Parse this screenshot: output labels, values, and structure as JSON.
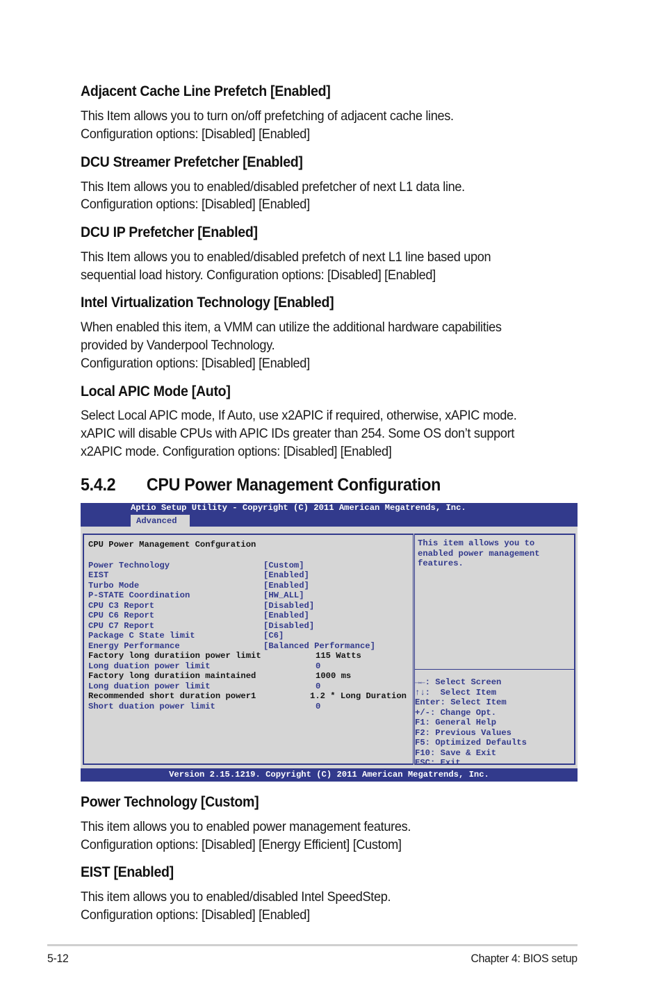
{
  "sections_top": [
    {
      "heading": "Adjacent Cache Line Prefetch [Enabled]",
      "lines": [
        "This Item allows you to turn on/off prefetching of adjacent cache lines.",
        "Configuration options: [Disabled] [Enabled]"
      ]
    },
    {
      "heading": "DCU Streamer Prefetcher [Enabled]",
      "lines": [
        "This Item allows you to enabled/disabled prefetcher of next L1 data line.",
        "Configuration options: [Disabled] [Enabled]"
      ]
    },
    {
      "heading": "DCU IP Prefetcher [Enabled]",
      "lines": [
        "This Item allows you to enabled/disabled prefetch of next L1 line based upon",
        "sequential load history. Configuration options: [Disabled] [Enabled]"
      ]
    },
    {
      "heading": "Intel Virtualization Technology [Enabled]",
      "lines": [
        "When enabled this item, a VMM can utilize the additional hardware capabilities",
        "provided by Vanderpool Technology.",
        "Configuration options: [Disabled] [Enabled]"
      ]
    },
    {
      "heading": "Local APIC Mode [Auto]",
      "lines": [
        "Select Local APIC mode, If Auto, use x2APIC if required, otherwise, xAPIC mode.",
        "xAPIC will disable CPUs with APIC IDs greater than 254. Some OS don’t support",
        "x2APIC mode. Configuration options: [Disabled] [Enabled]"
      ]
    }
  ],
  "section_heading": {
    "number": "5.4.2",
    "title": "CPU Power Management Configuration"
  },
  "bios": {
    "title": "Aptio Setup Utility - Copyright (C) 2011 American Megatrends, Inc.",
    "tab": "Advanced",
    "panel_title": "CPU Power Management Confguration",
    "items": [
      {
        "label": "Power Technology",
        "value": "[Custom]",
        "selectable": true
      },
      {
        "label": "EIST",
        "value": "[Enabled]",
        "selectable": true
      },
      {
        "label": "Turbo Mode",
        "value": "[Enabled]",
        "selectable": true
      },
      {
        "label": "P-STATE Coordination",
        "value": "[HW_ALL]",
        "selectable": true
      },
      {
        "label": "CPU C3 Report",
        "value": "[Disabled]",
        "selectable": true
      },
      {
        "label": "CPU C6 Report",
        "value": "[Enabled]",
        "selectable": true
      },
      {
        "label": "CPU C7 Report",
        "value": "[Disabled]",
        "selectable": true
      },
      {
        "label": "Package C State limit",
        "value": "[C6]",
        "selectable": true
      },
      {
        "label": "Energy Performance",
        "value": "[Balanced Performance]",
        "selectable": true
      },
      {
        "label": "Factory long duratiion power limit",
        "value": "115 Watts",
        "selectable": false
      },
      {
        "label": "Long duation power limit",
        "value": "0",
        "selectable": true
      },
      {
        "label": "Factory long duratiion maintained",
        "value": "1000 ms",
        "selectable": false
      },
      {
        "label": "Long duation power limit",
        "value": "0",
        "selectable": true
      },
      {
        "label": "Recommended short duration power1",
        "value": "1.2 * Long Duration",
        "selectable": false
      },
      {
        "label": "Short duation power limit",
        "value": "0",
        "selectable": true
      }
    ],
    "help_text": [
      "This item allows you to",
      "enabled power management",
      "features."
    ],
    "keys": [
      "→←: Select Screen",
      "↑↓:  Select Item",
      "Enter: Select Item",
      "+/-: Change Opt.",
      "F1: General Help",
      "F2: Previous Values",
      "F5: Optimized Defaults",
      "F10: Save & Exit",
      "ESC: Exit"
    ],
    "footer": "Version 2.15.1219. Copyright (C) 2011 American Megatrends, Inc.",
    "colors": {
      "frame": "#323a8c",
      "background": "#d6d6d6",
      "header_text": "#ffffff"
    }
  },
  "sections_bottom": [
    {
      "heading": "Power Technology [Custom]",
      "lines": [
        "This item allows you to enabled power management features.",
        "Configuration options: [Disabled] [Energy Efficient] [Custom]"
      ]
    },
    {
      "heading": "EIST [Enabled]",
      "lines": [
        "This item allows you to enabled/disabled Intel SpeedStep.",
        "Configuration options: [Disabled] [Enabled]"
      ]
    }
  ],
  "footer": {
    "page": "5-12",
    "chapter": "Chapter 4: BIOS setup"
  }
}
